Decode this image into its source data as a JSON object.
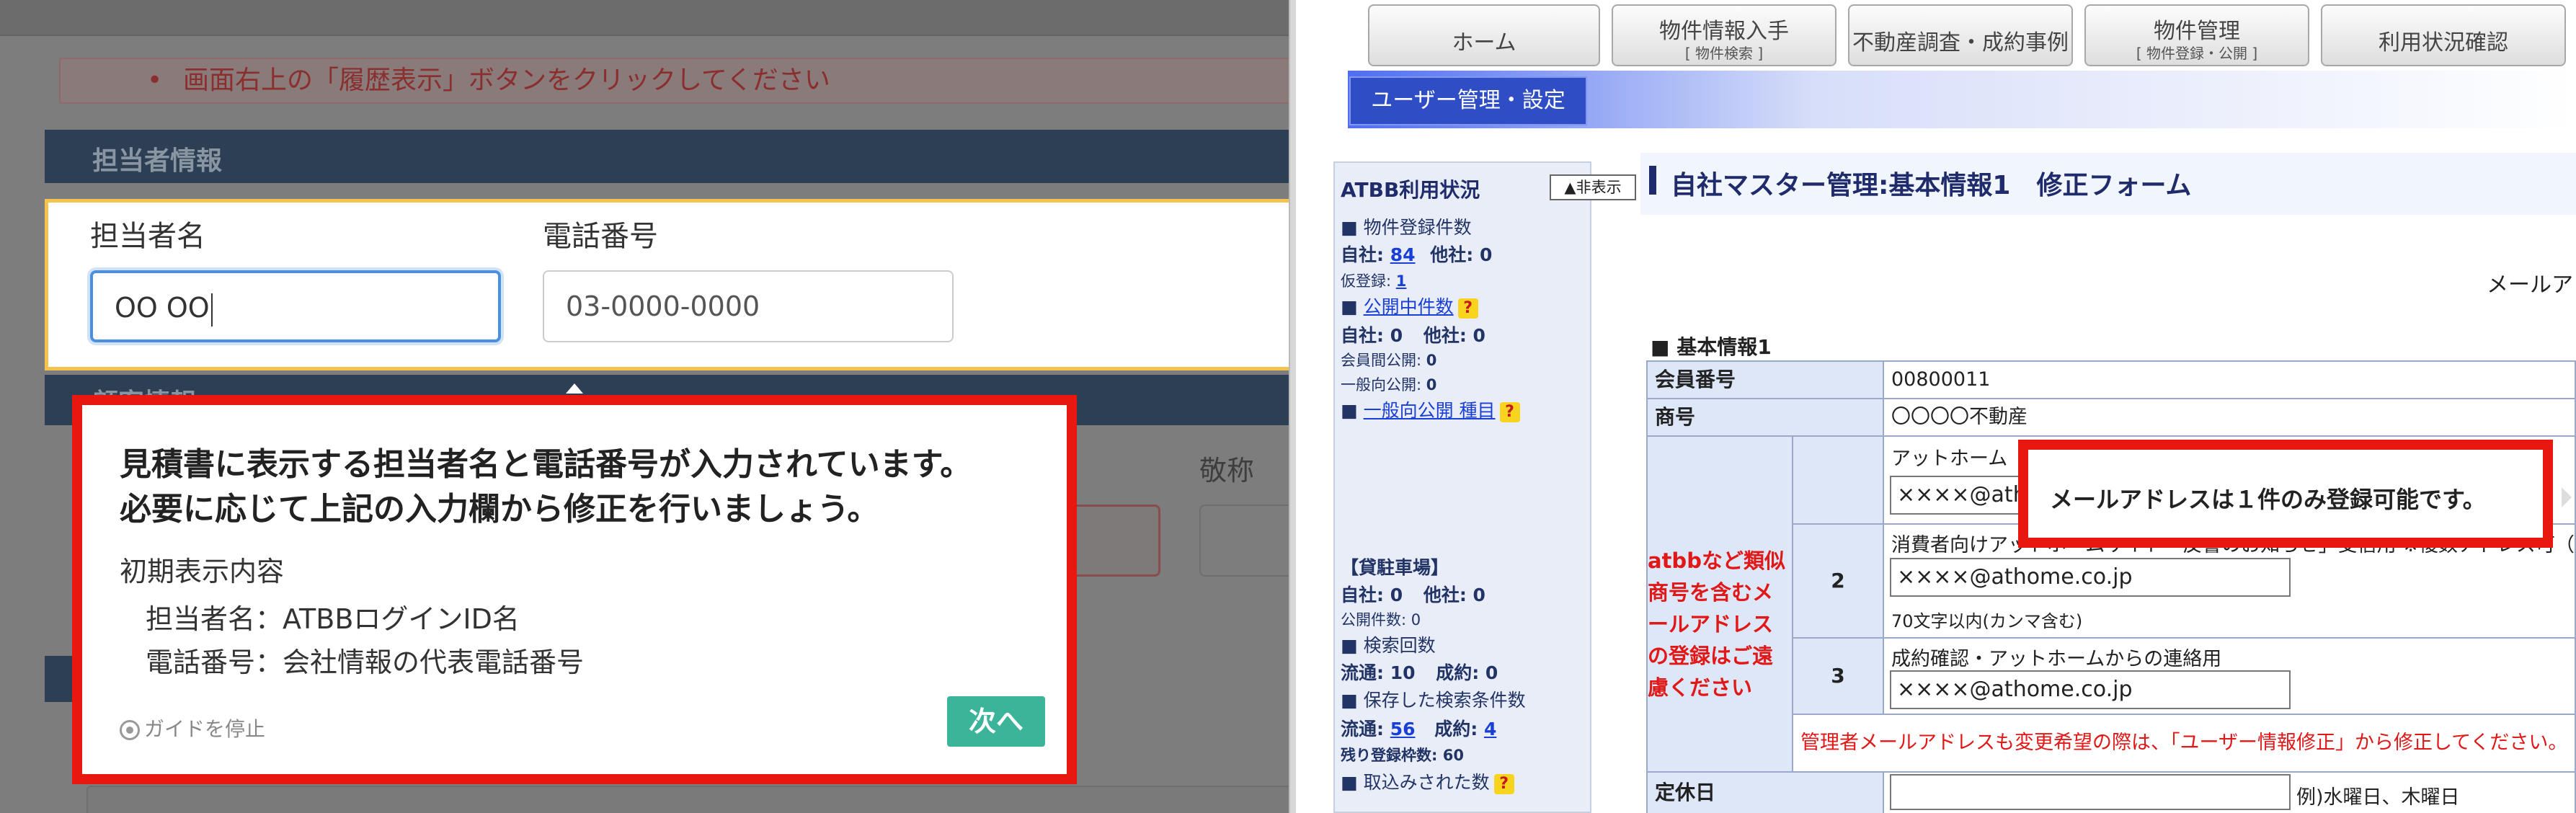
{
  "left": {
    "alert": {
      "bullet": "•",
      "text": "画面右上の「履歴表示」ボタンをクリックしてください"
    },
    "section_tanto": "担当者情報",
    "section_kokyaku": "顧客情報",
    "name_label": "担当者名",
    "tel_label": "電話番号",
    "name_value": "OO OO",
    "tel_value": "03-0000-0000",
    "keisho_label": "敬称",
    "guide": {
      "line1": "見積書に表示する担当者名と電話番号が入力されています。",
      "line2": "必要に応じて上記の入力欄から修正を行いましょう。",
      "desc_title": "初期表示内容",
      "desc_name": "担当者名：ATBBログインID名",
      "desc_tel": "電話番号：会社情報の代表電話番号",
      "stop_label": "ガイドを停止",
      "next_label": "次へ"
    }
  },
  "right": {
    "nav": [
      {
        "main": "ホーム",
        "sub": ""
      },
      {
        "main": "物件情報入手",
        "sub": "[ 物件検索 ]"
      },
      {
        "main": "不動産調査・成約事例",
        "sub": ""
      },
      {
        "main": "物件管理",
        "sub": "[ 物件登録・公開 ]"
      },
      {
        "main": "利用状況確認",
        "sub": ""
      }
    ],
    "user_btn": "ユーザー管理・設定",
    "sidebar": {
      "title": "ATBB利用状況",
      "hide_btn": "▲非表示",
      "reg_count_title": "■ 物件登録件数",
      "jisha_label": "自社:",
      "jisha_val": "84",
      "tasha_label": "他社:",
      "tasha_val": "0",
      "kari_label": "仮登録:",
      "kari_val": "1",
      "kokai_title": "公開中件数",
      "kokai_jisha": "自社: 0",
      "kokai_tasha": "他社: 0",
      "kaiinkan_label": "会員間公開:",
      "kaiinkan_val": "0",
      "ippan_label": "一般向公開:",
      "ippan_val": "0",
      "ippan_title": "一般向公開 種目",
      "kashi_title": "【貸駐車場】",
      "kashi_jisha": "自社: 0",
      "kashi_tasha": "他社: 0",
      "kashi_kokai": "公開件数: 0",
      "kensaku_title": "■ 検索回数",
      "kensaku_ryutsu": "流通: 10",
      "kensaku_seiyaku": "成約: 0",
      "hozon_title": "■ 保存した検索条件数",
      "hozon_ryutsu_label": "流通:",
      "hozon_ryutsu_val": "56",
      "hozon_seiyaku_label": "成約:",
      "hozon_seiyaku_val": "4",
      "nokori": "残り登録枠数: 60",
      "torikomi": "■ 取込みされた数"
    },
    "title": "自社マスター管理:基本情報1　修正フォーム",
    "mail_right": "メールアド",
    "kihon": "■ 基本情報1",
    "rows": {
      "kaiin_label": "会員番号",
      "kaiin_val": "00800011",
      "shogo_label": "商号",
      "shogo_val": "〇〇〇〇不動産",
      "mail1_note": "アットホーム『会員ページ』反響受信用",
      "mail1_val": "××××@athome.co.jp",
      "mail2_note": "消費者向けアットホームサイト「反響のお知らせ」受信用 ※複数アドレス可（",
      "mail2_num": "2",
      "mail2_val": "××××@athome.co.jp",
      "mail2_sub": "70文字以内(カンマ含む)",
      "mail3_note": "成約確認・アットホームからの連絡用",
      "mail3_num": "3",
      "mail3_val": "××××@athome.co.jp",
      "admin_note": "管理者メールアドレスも変更希望の際は、「ユーザー情報修正」から修正してください。",
      "teikyu_label": "定休日",
      "teikyu_hint": "例)水曜日、木曜日"
    },
    "warn_red": "atbbなど類似商号を含むメールアドレスの登録はご遠慮ください",
    "guide_msg": "メールアドレスは１件のみ登録可能です。"
  }
}
